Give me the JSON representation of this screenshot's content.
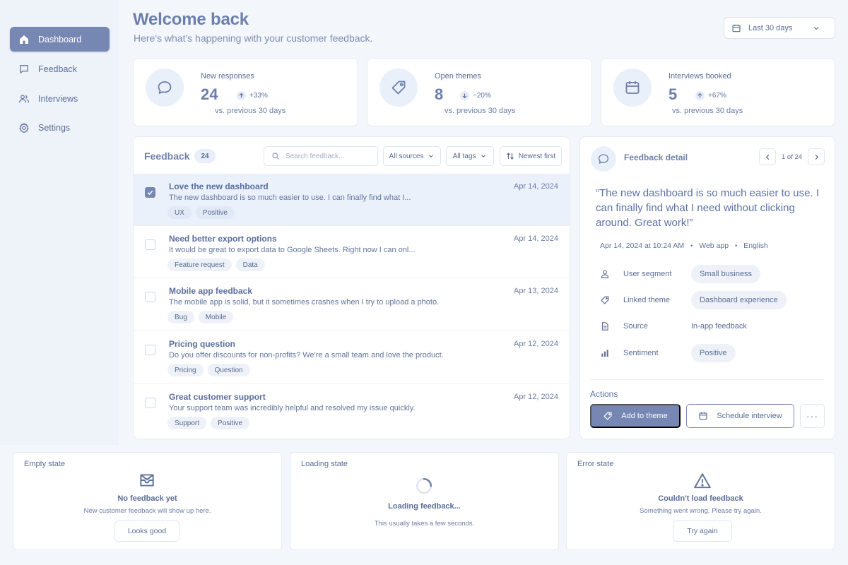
{
  "sidebar": {
    "items": [
      {
        "label": "Dashboard",
        "icon": "home-icon",
        "active": true
      },
      {
        "label": "Feedback",
        "icon": "message-icon",
        "active": false
      },
      {
        "label": "Interviews",
        "icon": "users-icon",
        "active": false
      },
      {
        "label": "Settings",
        "icon": "gear-icon",
        "active": false
      }
    ]
  },
  "header": {
    "title": "Welcome back",
    "subtitle": "Here's what's happening with your customer feedback.",
    "date_range": "Last 30 days"
  },
  "stats": [
    {
      "label": "New responses",
      "value": "24",
      "delta": "+33%",
      "direction": "up",
      "compare": "vs. previous 30 days",
      "icon": "chat-bubble-icon"
    },
    {
      "label": "Open themes",
      "value": "8",
      "delta": "−20%",
      "direction": "down",
      "compare": "vs. previous 30 days",
      "icon": "tag-icon"
    },
    {
      "label": "Interviews booked",
      "value": "5",
      "delta": "+67%",
      "direction": "up",
      "compare": "vs. previous 30 days",
      "icon": "calendar-icon"
    }
  ],
  "feedback_list": {
    "title": "Feedback",
    "count": "24",
    "search_placeholder": "Search feedback...",
    "filter_sources": "All sources",
    "filter_tags": "All tags",
    "sort": "Newest first",
    "items": [
      {
        "title": "Love the new dashboard",
        "snippet": "The new dashboard is so much easier to use. I can finally find what I...",
        "date": "Apr 14, 2024",
        "tags": [
          "UX",
          "Positive"
        ],
        "selected": true
      },
      {
        "title": "Need better export options",
        "snippet": "It would be great to export data to Google Sheets. Right now I can onl...",
        "date": "Apr 14, 2024",
        "tags": [
          "Feature request",
          "Data"
        ],
        "selected": false
      },
      {
        "title": "Mobile app feedback",
        "snippet": "The mobile app is solid, but it sometimes crashes when I try to upload a photo.",
        "date": "Apr 13, 2024",
        "tags": [
          "Bug",
          "Mobile"
        ],
        "selected": false
      },
      {
        "title": "Pricing question",
        "snippet": "Do you offer discounts for non-profits? We're a small team and love the product.",
        "date": "Apr 12, 2024",
        "tags": [
          "Pricing",
          "Question"
        ],
        "selected": false
      },
      {
        "title": "Great customer support",
        "snippet": "Your support team was incredibly helpful and resolved my issue quickly.",
        "date": "Apr 12, 2024",
        "tags": [
          "Support",
          "Positive"
        ],
        "selected": false
      }
    ]
  },
  "detail": {
    "title": "Feedback detail",
    "pager": "1 of 24",
    "quote": "“The new dashboard is so much easier to use. I can finally find what I need without clicking around. Great work!”",
    "meta": {
      "datetime": "Apr 14, 2024 at 10:24 AM",
      "channel": "Web app",
      "language": "English"
    },
    "fields": [
      {
        "label": "User segment",
        "value": "Small business",
        "style": "pill",
        "icon": "user-icon"
      },
      {
        "label": "Linked theme",
        "value": "Dashboard experience",
        "style": "pill",
        "icon": "tag-icon"
      },
      {
        "label": "Source",
        "value": "In-app feedback",
        "style": "text",
        "icon": "document-icon"
      },
      {
        "label": "Sentiment",
        "value": "Positive",
        "style": "pill",
        "icon": "bar-chart-icon"
      }
    ],
    "actions_label": "Actions",
    "add_to_theme": "Add to theme",
    "schedule_interview": "Schedule interview",
    "more": "···"
  },
  "states": {
    "empty": {
      "label": "Empty state",
      "title": "No feedback yet",
      "desc": "New customer feedback will show up here.",
      "button": "Looks good"
    },
    "loading": {
      "label": "Loading state",
      "title": "Loading feedback...",
      "desc": "This usually takes a few seconds."
    },
    "error": {
      "label": "Error state",
      "title": "Couldn't load feedback",
      "desc": "Something went wrong. Please try again.",
      "button": "Try again"
    }
  },
  "colors": {
    "accent": "#7687b4",
    "page_bg": "#f3f6fb",
    "sidebar_bg": "#eef2f9",
    "text": "#5a6d97"
  }
}
